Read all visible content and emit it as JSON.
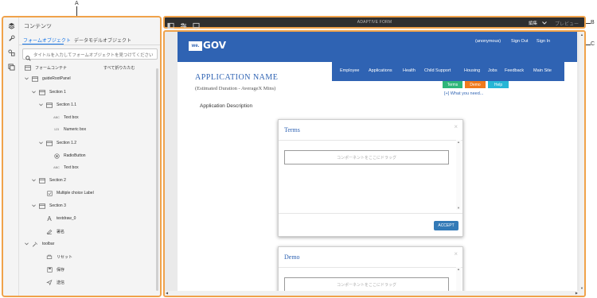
{
  "callouts": {
    "a": "A",
    "b": "B",
    "c": "C"
  },
  "rail": {
    "icons": [
      "layers-icon",
      "wrench-icon",
      "data-sources-icon",
      "assets-icon"
    ]
  },
  "panel": {
    "title": "コンテンツ",
    "tabs": [
      "フォームオブジェクト",
      "データモデルオブジェクト"
    ],
    "search_placeholder": "タイトルを入力してフォームオブジェクトを見つけてください",
    "tree_header": "フォームコンテナ",
    "collapse_all": "すべて折りたたむ",
    "items": [
      {
        "label": "guideRootPanel",
        "icon": "panel-icon",
        "expanded": true
      },
      {
        "label": "Section 1",
        "icon": "panel-icon",
        "expanded": true
      },
      {
        "label": "Section 1.1",
        "icon": "panel-icon",
        "expanded": true
      },
      {
        "label": "Text box",
        "icon": "ABC"
      },
      {
        "label": "Numeric box",
        "icon": "123"
      },
      {
        "label": "Section 1.2",
        "icon": "panel-icon",
        "expanded": true
      },
      {
        "label": "RadioButton",
        "icon": "radio-icon"
      },
      {
        "label": "Text box",
        "icon": "ABC"
      },
      {
        "label": "Section 2",
        "icon": "panel-icon",
        "expanded": true
      },
      {
        "label": "Multiple choice Label",
        "icon": "checkbox-icon"
      },
      {
        "label": "Section 3",
        "icon": "panel-icon",
        "expanded": true
      },
      {
        "label": "textdraw_0",
        "icon": "A"
      },
      {
        "label": "署名",
        "icon": "signature-icon"
      },
      {
        "label": "toolbar",
        "icon": "toolbar-icon",
        "expanded": true
      },
      {
        "label": "リセット",
        "icon": "reset-icon"
      },
      {
        "label": "保存",
        "icon": "save-icon"
      },
      {
        "label": "送信",
        "icon": "send-icon"
      }
    ]
  },
  "editor": {
    "title": "ADAPTIVE FORM",
    "mode": "編集",
    "preview": "プレビュー"
  },
  "site": {
    "logo_box": "we.",
    "logo_text": "GOV",
    "top_links": [
      "(anonymous)",
      "Sign Out",
      "Sign In"
    ],
    "nav": [
      "Employee",
      "Applications",
      "Health",
      "Child Support",
      "Housing",
      "Jobs",
      "Feedback",
      "Main Site"
    ],
    "app_name": "APPLICATION NAME",
    "duration": "(Estimated Duration - AverageX Mins)",
    "description": "Application Description",
    "pills": [
      {
        "label": "Terms",
        "color": "#2fb67a"
      },
      {
        "label": "Demo",
        "color": "#f07a1c"
      },
      {
        "label": "Help",
        "color": "#27b6d6"
      }
    ],
    "what_need": "[+] What you need...",
    "modals": [
      {
        "title": "Terms",
        "drop": "コンポーネントをここにドラッグ",
        "accept": "ACCEPT"
      },
      {
        "title": "Demo",
        "drop": "コンポーネントをここにドラッグ"
      }
    ]
  },
  "colors": {
    "highlight": "#f0a24a",
    "gov_blue": "#2f63b3",
    "accept_blue": "#337ab7"
  }
}
